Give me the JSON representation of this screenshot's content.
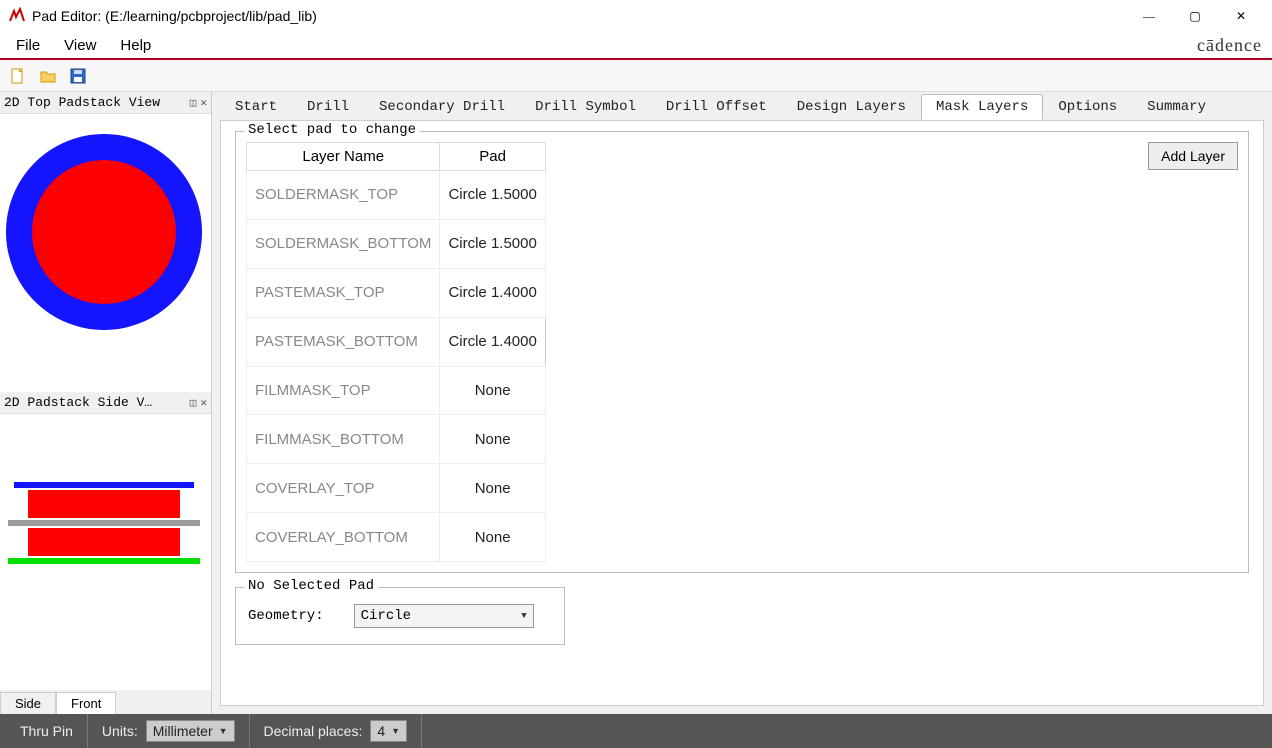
{
  "window": {
    "title": "Pad Editor:  (E:/learning/pcbproject/lib/pad_lib)"
  },
  "menu": {
    "file": "File",
    "view": "View",
    "help": "Help"
  },
  "brand": "cādence",
  "panels": {
    "top_view_title": "2D Top Padstack View",
    "side_view_title": "2D Padstack Side V…",
    "side_tabs": {
      "side": "Side",
      "front": "Front"
    }
  },
  "tabs": {
    "start": "Start",
    "drill": "Drill",
    "secondary_drill": "Secondary Drill",
    "drill_symbol": "Drill Symbol",
    "drill_offset": "Drill Offset",
    "design_layers": "Design Layers",
    "mask_layers": "Mask Layers",
    "options": "Options",
    "summary": "Summary"
  },
  "panel": {
    "select_pad_label": "Select pad to change",
    "add_layer_label": "Add Layer",
    "columns": {
      "layer": "Layer Name",
      "pad": "Pad"
    },
    "rows": [
      {
        "layer": "SOLDERMASK_TOP",
        "pad": "Circle 1.5000"
      },
      {
        "layer": "SOLDERMASK_BOTTOM",
        "pad": "Circle 1.5000"
      },
      {
        "layer": "PASTEMASK_TOP",
        "pad": "Circle 1.4000"
      },
      {
        "layer": "PASTEMASK_BOTTOM",
        "pad": "Circle 1.4000"
      },
      {
        "layer": "FILMMASK_TOP",
        "pad": "None"
      },
      {
        "layer": "FILMMASK_BOTTOM",
        "pad": "None"
      },
      {
        "layer": "COVERLAY_TOP",
        "pad": "None"
      },
      {
        "layer": "COVERLAY_BOTTOM",
        "pad": "None"
      }
    ],
    "selected_row_index": 3,
    "no_selected_pad": "No Selected Pad",
    "geometry_label": "Geometry:",
    "geometry_value": "Circle"
  },
  "status": {
    "pin_type": "Thru Pin",
    "units_label": "Units:",
    "units_value": "Millimeter",
    "decimal_label": "Decimal places:",
    "decimal_value": "4"
  }
}
